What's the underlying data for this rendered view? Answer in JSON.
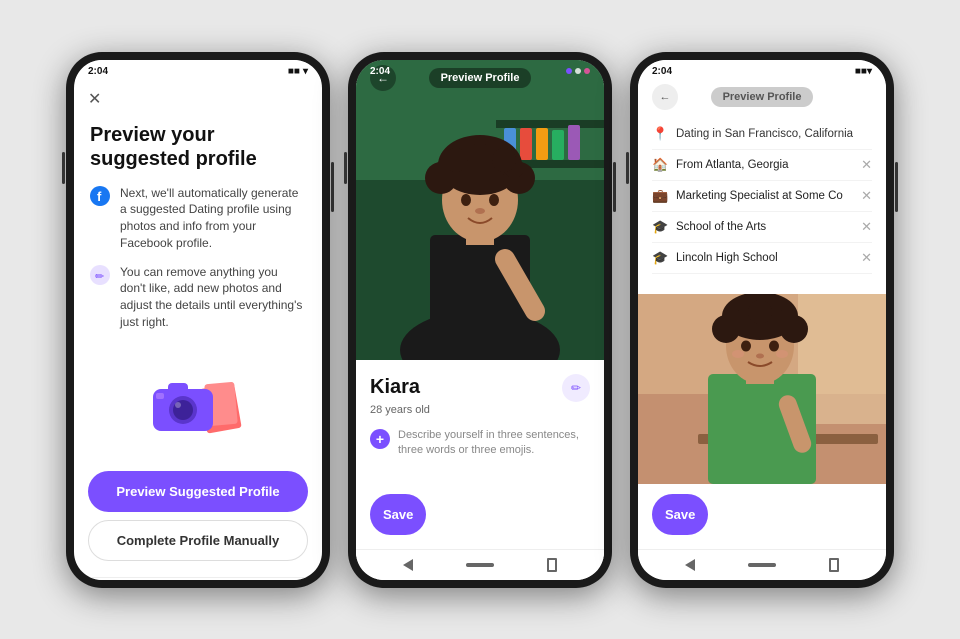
{
  "scene": {
    "bg": "#e8e8e8"
  },
  "phone1": {
    "status_time": "2:04",
    "close_icon": "✕",
    "title": "Preview your suggested profile",
    "item1_text": "Next, we'll automatically generate a suggested Dating profile using photos and info from your Facebook profile.",
    "item2_text": "You can remove anything you don't like, add new photos and adjust the details until everything's just right.",
    "btn_primary": "Preview Suggested Profile",
    "btn_secondary": "Complete Profile Manually"
  },
  "phone2": {
    "status_time": "2:04",
    "header_label": "Preview Profile",
    "back_icon": "←",
    "name": "Kiara",
    "age": "28 years old",
    "bio_placeholder": "Describe yourself in three sentences, three words or three emojis.",
    "edit_icon": "✏",
    "add_icon": "+",
    "save_label": "Save"
  },
  "phone3": {
    "status_time": "2:04",
    "header_label": "Preview Profile",
    "back_icon": "←",
    "location_label": "Dating in San Francisco, California",
    "from_label": "From Atlanta, Georgia",
    "job_label": "Marketing Specialist at Some Co",
    "school1_label": "School of the Arts",
    "school2_label": "Lincoln High School",
    "save_label": "Save",
    "x_icon": "✕"
  }
}
